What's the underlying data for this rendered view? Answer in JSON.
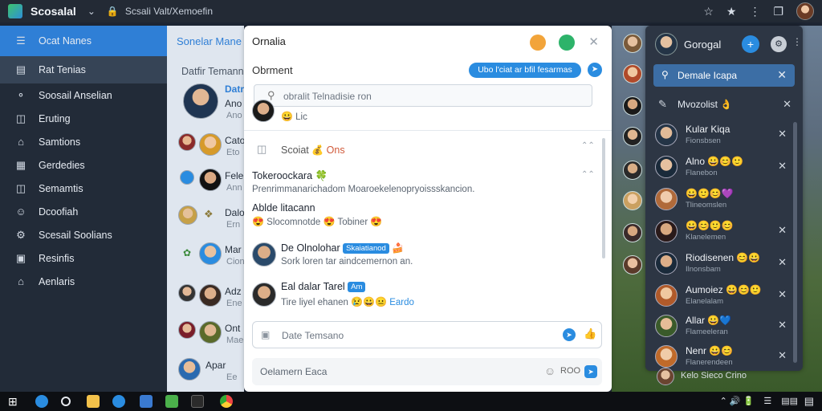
{
  "titlebar": {
    "app_name": "Scosalal",
    "path": "Scsali Valt/Xemoefin",
    "chevron": "chevron-down-icon",
    "lock": "lock-icon"
  },
  "sidebar": {
    "items": [
      {
        "label": "Ocat Nanes",
        "icon": "list-icon"
      },
      {
        "label": "Rat Tenias",
        "icon": "list-icon"
      },
      {
        "label": "Soosail Anselian",
        "icon": "chat-icon"
      },
      {
        "label": "Eruting",
        "icon": "bookmark-icon"
      },
      {
        "label": "Samtions",
        "icon": "home-icon"
      },
      {
        "label": "Gerdedies",
        "icon": "grid-icon"
      },
      {
        "label": "Semamtis",
        "icon": "bookmark-icon"
      },
      {
        "label": "Dcoofiah",
        "icon": "user-icon"
      },
      {
        "label": "Scesail Soolians",
        "icon": "gear-icon"
      },
      {
        "label": "Resinfis",
        "icon": "image-icon"
      },
      {
        "label": "Aenlaris",
        "icon": "home-icon"
      }
    ]
  },
  "contacts": {
    "title": "Sonelar Mane",
    "subtitle": "Datfir Temanno",
    "rows": [
      {
        "name": "Datri",
        "sub": "Ano",
        "sub2": "Ano",
        "color": "#2f7fd6"
      },
      {
        "name": "Cato",
        "sub": "Eto"
      },
      {
        "name": "Fele",
        "sub": "Ann"
      },
      {
        "name": "Dalo",
        "sub": "Ern"
      },
      {
        "name": "Mar",
        "sub": "Cion"
      },
      {
        "name": "Adz",
        "sub": "Ene"
      },
      {
        "name": "Ont",
        "sub": "Mae"
      },
      {
        "name": "Apar",
        "sub": "Ee"
      }
    ]
  },
  "chat": {
    "title": "Ornalia",
    "label": "Obrment",
    "pill": "Ubo l'ciat ar bfil fesarmas",
    "search_placeholder": "obralit Telnadisie ron",
    "search_meta": "Lic",
    "messages": [
      {
        "name": "Scoiat",
        "tag": "Ons",
        "badge": "💰"
      },
      {
        "name": "Tokeroockara 🍀",
        "sub": "Prenrimmanarichadom Moaroekelenopryoissskancion."
      },
      {
        "name": "Ablde litacann",
        "sub": "Slocomnotde",
        "extra": "Tobiner"
      },
      {
        "name": "De Olnolohar",
        "tag": "Skaiatianod",
        "sub": "Sork loren tar aindcemernon an."
      },
      {
        "name": "Eal dalar Tarel",
        "tag": "Am",
        "sub": "Tire liyel ehanen",
        "extra": "Eardo"
      }
    ],
    "compose_placeholder": "Date Temsano",
    "compose2_placeholder": "Oelamern Eaca",
    "compose2_count": "ROO"
  },
  "friends": {
    "title": "Gorogal",
    "selected": "Demale Icapa",
    "row2": "Mvozolist",
    "items": [
      {
        "name": "Kular Kiqa",
        "sub": "Fionsbsen"
      },
      {
        "name": "Alno",
        "sub": "Flanebon"
      },
      {
        "name": "",
        "sub": "Tlineomslen"
      },
      {
        "name": "",
        "sub": "Klanelemen"
      },
      {
        "name": "Riodisenen",
        "sub": "Ilnonsbam"
      },
      {
        "name": "Aumoiez",
        "sub": "Elanelalam"
      },
      {
        "name": "Allar",
        "sub": "Flameeleran"
      },
      {
        "name": "Nenr",
        "sub": "Flanerendeen"
      }
    ],
    "footer": "Kelo Sieco Crino"
  },
  "taskbar": {
    "tray": "⌃ 🔊 🔋"
  },
  "colors": {
    "accent": "#2a8ce0",
    "sidebar_bg": "#222b38",
    "sidebar_active": "#2f7fd6"
  }
}
